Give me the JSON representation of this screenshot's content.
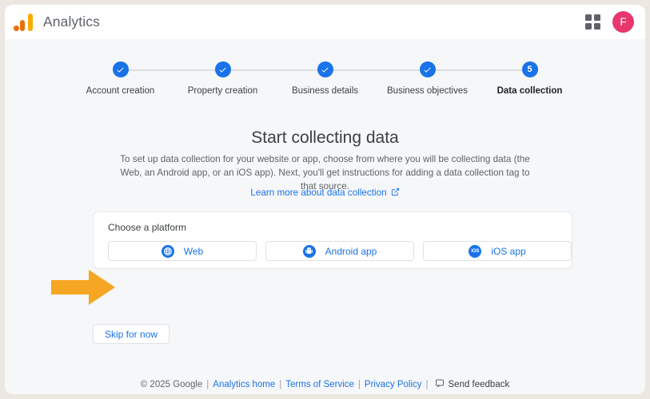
{
  "colors": {
    "accent_blue": "#1a73e8",
    "avatar_pink": "#e8366e",
    "logo_yellow": "#f9ab00",
    "logo_orange": "#e8710a",
    "arrow_orange": "#f5a623",
    "frame_beige": "#ece7e1",
    "page_bg": "#f6f7f9"
  },
  "topbar": {
    "logo_name": "analytics-logo",
    "title": "Analytics",
    "apps_icon": "apps-grid-icon",
    "avatar_initial": "F"
  },
  "stepper": {
    "steps": [
      {
        "label": "Account creation",
        "state": "complete",
        "marker": "check"
      },
      {
        "label": "Property creation",
        "state": "complete",
        "marker": "check"
      },
      {
        "label": "Business details",
        "state": "complete",
        "marker": "check"
      },
      {
        "label": "Business objectives",
        "state": "complete",
        "marker": "check"
      },
      {
        "label": "Data collection",
        "state": "current",
        "marker": "5"
      }
    ]
  },
  "main": {
    "heading": "Start collecting data",
    "description": "To set up data collection for your website or app, choose from where you will be collecting data (the Web, an Android app, or an iOS app). Next, you'll get instructions for adding a data collection tag to that source.",
    "learn_more_label": "Learn more about data collection",
    "learn_more_icon": "external-link-icon",
    "card": {
      "title": "Choose a platform",
      "platforms": [
        {
          "label": "Web",
          "icon": "globe-icon"
        },
        {
          "label": "Android app",
          "icon": "android-icon"
        },
        {
          "label": "iOS app",
          "icon": "ios-icon"
        }
      ]
    },
    "skip_label": "Skip for now",
    "annotation": {
      "name": "orange-arrow-pointer",
      "points_to": "Web"
    }
  },
  "footer": {
    "copyright": "© 2025 Google",
    "links": [
      {
        "label": "Analytics home"
      },
      {
        "label": "Terms of Service"
      },
      {
        "label": "Privacy Policy"
      }
    ],
    "separator": "|",
    "feedback_label": "Send feedback",
    "feedback_icon": "feedback-icon"
  }
}
